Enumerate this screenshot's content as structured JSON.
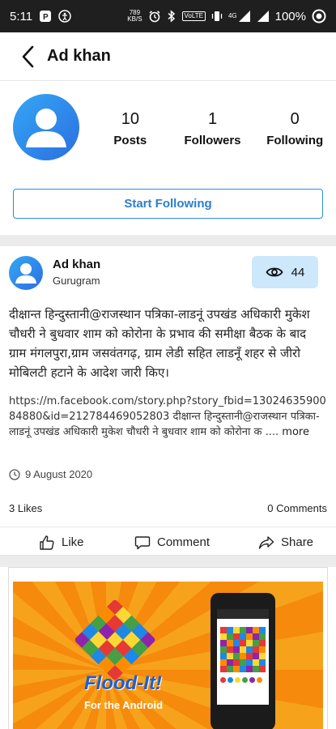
{
  "status_bar": {
    "time": "5:11",
    "net_speed_top": "789",
    "net_speed_unit": "KB/S",
    "volte": "VoLTE",
    "signal_type": "4G",
    "battery": "100%"
  },
  "header": {
    "title": "Ad khan"
  },
  "profile": {
    "stats": [
      {
        "value": "10",
        "label": "Posts"
      },
      {
        "value": "1",
        "label": "Followers"
      },
      {
        "value": "0",
        "label": "Following"
      }
    ],
    "follow_button": "Start Following"
  },
  "post": {
    "author": "Ad khan",
    "location": "Gurugram",
    "views": "44",
    "text": "दीक्षान्त हिन्दुस्तानी@राजस्थान पत्रिका-लाडनूं उपखंड अधिकारी मुकेश चौधरी ने बुधवार शाम को कोरोना के प्रभाव की समीक्षा बैठक के बाद ग्राम मंगलपुरा,ग्राम जसवंतगढ़, ग्राम लेडी सहित लाडनूँ शहर से जीरो मोबिलटी हटाने के आदेश जारी किए।",
    "link_preview": "https://m.facebook.com/story.php?story_fbid=1302463590084880&id=212784469052803 दीक्षान्त हिन्दुस्तानी@राजस्थान पत्रिका-लाडनूं उपखंड अधिकारी मुकेश चौधरी ने बुधवार शाम को कोरोना क ....",
    "more_label": "more",
    "date": "9 August 2020",
    "likes": "3 Likes",
    "comments": "0 Comments",
    "actions": {
      "like": "Like",
      "comment": "Comment",
      "share": "Share"
    }
  },
  "ad": {
    "title": "Flood-It!",
    "subtitle": "For the Android"
  },
  "colors": {
    "accent": "#2a7fc9",
    "views_bg": "#cde7fb",
    "status_bar": "#1f1f1f",
    "ad_orange": "#f7a21b"
  }
}
